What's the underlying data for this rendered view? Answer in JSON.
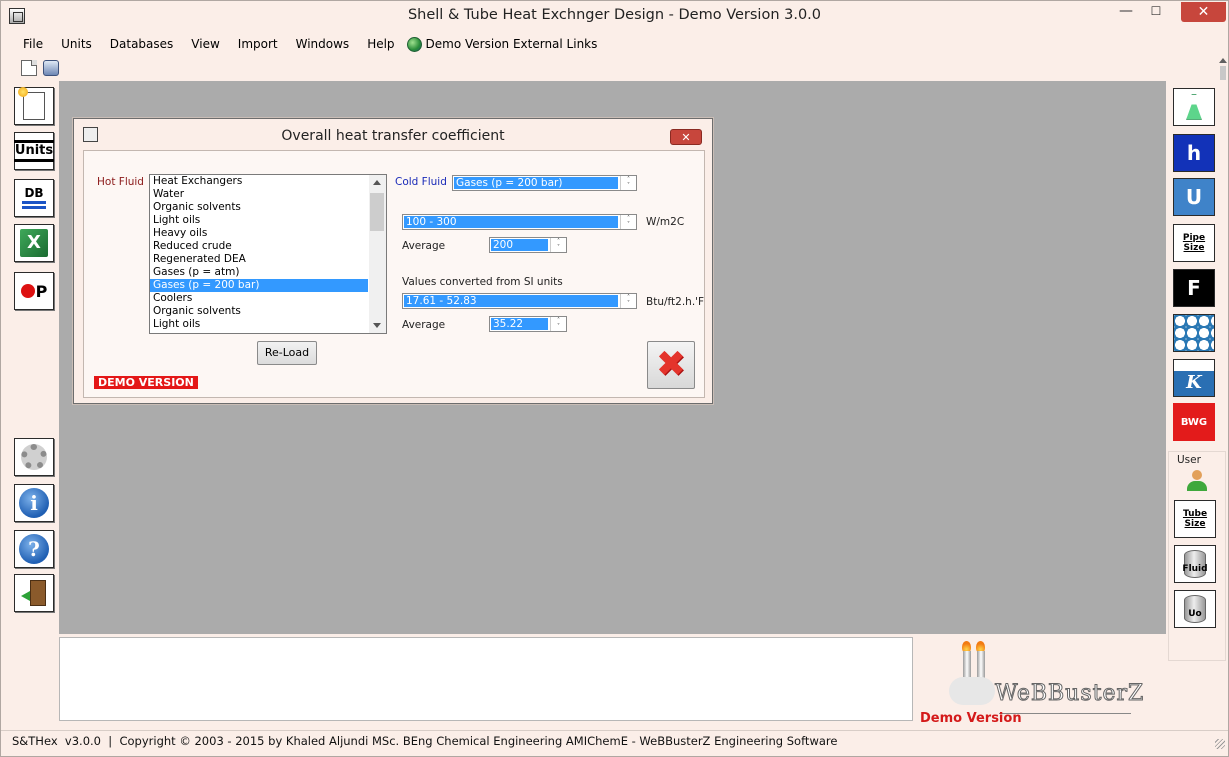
{
  "window": {
    "title": "Shell & Tube Heat Exchnger Design - Demo Version 3.0.0",
    "minimize": "—",
    "maximize": "☐",
    "close": "✕"
  },
  "menu": {
    "items": [
      "File",
      "Units",
      "Databases",
      "View",
      "Import",
      "Windows",
      "Help"
    ],
    "external_link": "Demo Version External Links"
  },
  "left_toolbar": {
    "units_label": "Units",
    "db_label": "DB",
    "excel_label": "X",
    "plant_label": "P",
    "info_label": "i",
    "help_label": "?"
  },
  "right_toolbar": {
    "h_label": "h",
    "u_label": "U",
    "pipe_size_label": "Pipe Size",
    "f_label": "F",
    "k_label": "K",
    "bwg_label": "BWG",
    "user_label": "User",
    "tube_size_label": "Tube Size",
    "fluid_label": "Fluid",
    "uo_label": "Uo"
  },
  "dialog": {
    "title": "Overall heat transfer coefficient",
    "close_label": "✕",
    "hot_fluid_label": "Hot Fluid",
    "cold_fluid_label": "Cold Fluid",
    "hot_fluid_options": [
      "Heat Exchangers",
      "Water",
      "Organic solvents",
      "Light oils",
      "Heavy oils",
      "Reduced crude",
      "Regenerated DEA",
      "Gases (p = atm)",
      "Gases (p = 200 bar)",
      "Coolers",
      "Organic solvents",
      "Light oils"
    ],
    "hot_fluid_selected_index": 8,
    "cold_fluid_value": "Gases (p = 200 bar)",
    "si_range_value": "100 - 300",
    "si_unit": "W/m2C",
    "average_label": "Average",
    "si_average_value": "200",
    "converted_label": "Values converted from SI units",
    "conv_range_value": "17.61 - 52.83",
    "conv_unit": "Btu/ft2.h.'F",
    "conv_average_value": "35.22",
    "reload_label": "Re-Load",
    "cancel_icon": "✖",
    "demo_badge": "DEMO VERSION"
  },
  "branding": {
    "brand_name": "WeBBusterZ",
    "demo_version": "Demo Version"
  },
  "status_bar": {
    "text": "S&THex  v3.0.0  |  Copyright © 2003 - 2015 by Khaled Aljundi MSc. BEng Chemical Engineering AMIChemE - WeBBusterZ Engineering Software"
  }
}
